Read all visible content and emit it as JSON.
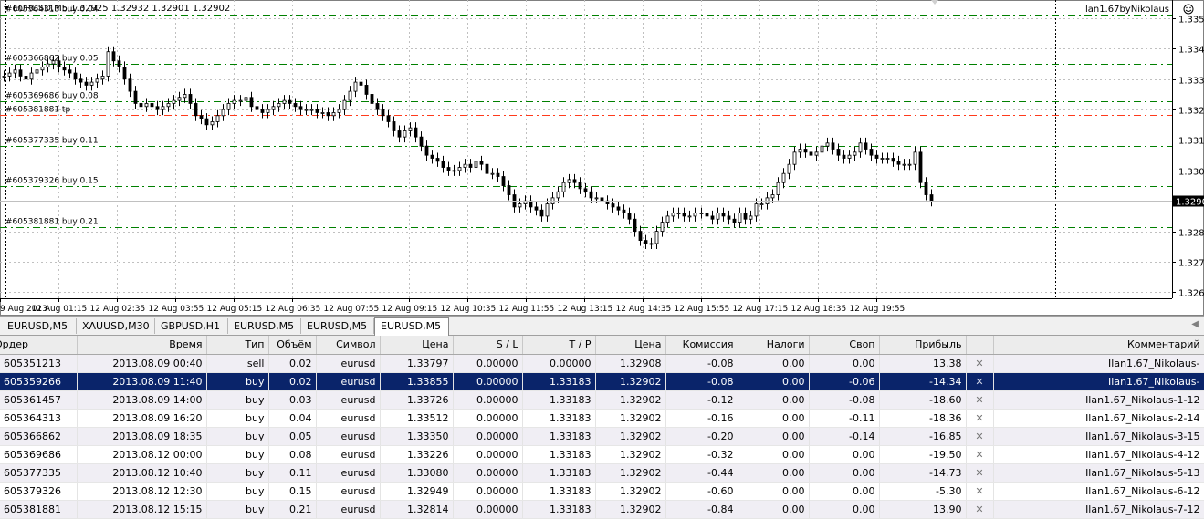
{
  "chart": {
    "header": "EURUSD,M5  1.32925 1.32932 1.32901 1.32902",
    "expert_label": "Ilan1.67byNikolaus",
    "current_price_label": "1.3290",
    "price_axis": [
      "1.3350",
      "1.3340",
      "1.3330",
      "1.3320",
      "1.3310",
      "1.3300",
      "1.3290",
      "1.3280",
      "1.3270",
      "1.3260"
    ],
    "time_axis": [
      "9 Aug 2013",
      "12 Aug 01:15",
      "12 Aug 02:35",
      "12 Aug 03:55",
      "12 Aug 05:15",
      "12 Aug 06:35",
      "12 Aug 07:55",
      "12 Aug 09:15",
      "12 Aug 10:35",
      "12 Aug 11:55",
      "12 Aug 13:15",
      "12 Aug 14:35",
      "12 Aug 15:55",
      "12 Aug 17:15",
      "12 Aug 18:35",
      "12 Aug 19:55"
    ],
    "order_lines": [
      {
        "label": "#605364313 buy 0.04",
        "price": 1.33512,
        "color": "#008000"
      },
      {
        "label": "#605366862 buy 0.05",
        "price": 1.3335,
        "color": "#008000"
      },
      {
        "label": "#605369686 buy 0.08",
        "price": 1.33226,
        "color": "#008000"
      },
      {
        "label": "#605381881 tp",
        "price": 1.33183,
        "color": "#ff3b1c"
      },
      {
        "label": "#605377335 buy 0.11",
        "price": 1.3308,
        "color": "#008000"
      },
      {
        "label": "#605379326 buy 0.15",
        "price": 1.32949,
        "color": "#008000"
      },
      {
        "label": "#605381881 buy 0.21",
        "price": 1.32814,
        "color": "#008000"
      }
    ],
    "close_series": [
      1.3331,
      1.3332,
      1.3333,
      1.3331,
      1.333,
      1.3332,
      1.3333,
      1.3334,
      1.3335,
      1.3336,
      1.3334,
      1.3333,
      1.3332,
      1.333,
      1.3329,
      1.3328,
      1.3329,
      1.333,
      1.3331,
      1.3339,
      1.3336,
      1.3334,
      1.333,
      1.3326,
      1.3322,
      1.3321,
      1.3322,
      1.3321,
      1.332,
      1.3321,
      1.3322,
      1.3323,
      1.3324,
      1.3325,
      1.3322,
      1.3318,
      1.3317,
      1.3315,
      1.3316,
      1.3318,
      1.332,
      1.3322,
      1.3323,
      1.3323,
      1.3324,
      1.3321,
      1.332,
      1.3319,
      1.332,
      1.3321,
      1.3322,
      1.3323,
      1.3322,
      1.3321,
      1.332,
      1.332,
      1.332,
      1.3319,
      1.3319,
      1.3318,
      1.3319,
      1.332,
      1.3323,
      1.3326,
      1.3329,
      1.3328,
      1.3325,
      1.3322,
      1.332,
      1.3318,
      1.3316,
      1.3313,
      1.3311,
      1.3313,
      1.3314,
      1.3311,
      1.3308,
      1.3305,
      1.3304,
      1.3303,
      1.3301,
      1.33,
      1.33,
      1.3301,
      1.3302,
      1.3301,
      1.3303,
      1.3302,
      1.3299,
      1.3299,
      1.3298,
      1.3295,
      1.3292,
      1.3288,
      1.3289,
      1.329,
      1.3288,
      1.3287,
      1.3285,
      1.3289,
      1.3291,
      1.3293,
      1.3296,
      1.3297,
      1.3296,
      1.3294,
      1.3293,
      1.3291,
      1.3291,
      1.329,
      1.3289,
      1.3288,
      1.3287,
      1.3286,
      1.3284,
      1.328,
      1.3277,
      1.3276,
      1.3276,
      1.328,
      1.3283,
      1.3285,
      1.3286,
      1.3286,
      1.3285,
      1.3285,
      1.3286,
      1.3286,
      1.3285,
      1.3284,
      1.3286,
      1.3285,
      1.3284,
      1.3283,
      1.3286,
      1.3284,
      1.3285,
      1.3289,
      1.3289,
      1.3291,
      1.3292,
      1.3296,
      1.3299,
      1.3302,
      1.3306,
      1.3307,
      1.3306,
      1.3305,
      1.3306,
      1.3308,
      1.3309,
      1.3307,
      1.3305,
      1.3304,
      1.3305,
      1.3306,
      1.3309,
      1.3307,
      1.3305,
      1.3304,
      1.3304,
      1.3304,
      1.3303,
      1.3302,
      1.3302,
      1.3302,
      1.3306,
      1.3296,
      1.3292,
      1.329
    ],
    "colors": {
      "grid": "#c0c0c0",
      "candle": "#000000",
      "buy_line": "#008000",
      "tp_line": "#ff3b1c",
      "price_marker": "#000000"
    }
  },
  "tabs": [
    {
      "label": "EURUSD,M5",
      "active": false
    },
    {
      "label": "XAUUSD,M30",
      "active": false
    },
    {
      "label": "GBPUSD,H1",
      "active": false
    },
    {
      "label": "EURUSD,M5",
      "active": false
    },
    {
      "label": "EURUSD,M5",
      "active": false
    },
    {
      "label": "EURUSD,M5",
      "active": true
    }
  ],
  "table": {
    "headers": [
      "Ордер",
      "Время",
      "Тип",
      "Объём",
      "Символ",
      "Цена",
      "S / L",
      "T / P",
      "Цена",
      "Комиссия",
      "Налоги",
      "Своп",
      "Прибыль",
      "",
      "Комментарий"
    ],
    "rows": [
      [
        "605351213",
        "2013.08.09 00:40",
        "sell",
        "0.02",
        "eurusd",
        "1.33797",
        "0.00000",
        "0.00000",
        "1.32908",
        "-0.08",
        "0.00",
        "0.00",
        "13.38",
        "Ilan1.67_Nikolaus-"
      ],
      [
        "605359266",
        "2013.08.09 11:40",
        "buy",
        "0.02",
        "eurusd",
        "1.33855",
        "0.00000",
        "1.33183",
        "1.32902",
        "-0.08",
        "0.00",
        "-0.06",
        "-14.34",
        "Ilan1.67_Nikolaus-"
      ],
      [
        "605361457",
        "2013.08.09 14:00",
        "buy",
        "0.03",
        "eurusd",
        "1.33726",
        "0.00000",
        "1.33183",
        "1.32902",
        "-0.12",
        "0.00",
        "-0.08",
        "-18.60",
        "Ilan1.67_Nikolaus-1-12"
      ],
      [
        "605364313",
        "2013.08.09 16:20",
        "buy",
        "0.04",
        "eurusd",
        "1.33512",
        "0.00000",
        "1.33183",
        "1.32902",
        "-0.16",
        "0.00",
        "-0.11",
        "-18.36",
        "Ilan1.67_Nikolaus-2-14"
      ],
      [
        "605366862",
        "2013.08.09 18:35",
        "buy",
        "0.05",
        "eurusd",
        "1.33350",
        "0.00000",
        "1.33183",
        "1.32902",
        "-0.20",
        "0.00",
        "-0.14",
        "-16.85",
        "Ilan1.67_Nikolaus-3-15"
      ],
      [
        "605369686",
        "2013.08.12 00:00",
        "buy",
        "0.08",
        "eurusd",
        "1.33226",
        "0.00000",
        "1.33183",
        "1.32902",
        "-0.32",
        "0.00",
        "0.00",
        "-19.50",
        "Ilan1.67_Nikolaus-4-12"
      ],
      [
        "605377335",
        "2013.08.12 10:40",
        "buy",
        "0.11",
        "eurusd",
        "1.33080",
        "0.00000",
        "1.33183",
        "1.32902",
        "-0.44",
        "0.00",
        "0.00",
        "-14.73",
        "Ilan1.67_Nikolaus-5-13"
      ],
      [
        "605379326",
        "2013.08.12 12:30",
        "buy",
        "0.15",
        "eurusd",
        "1.32949",
        "0.00000",
        "1.33183",
        "1.32902",
        "-0.60",
        "0.00",
        "0.00",
        "-5.30",
        "Ilan1.67_Nikolaus-6-12"
      ],
      [
        "605381881",
        "2013.08.12 15:15",
        "buy",
        "0.21",
        "eurusd",
        "1.32814",
        "0.00000",
        "1.33183",
        "1.32902",
        "-0.84",
        "0.00",
        "0.00",
        "13.90",
        "Ilan1.67_Nikolaus-7-12"
      ]
    ],
    "selected_row": 1,
    "close_glyph": "✕"
  }
}
